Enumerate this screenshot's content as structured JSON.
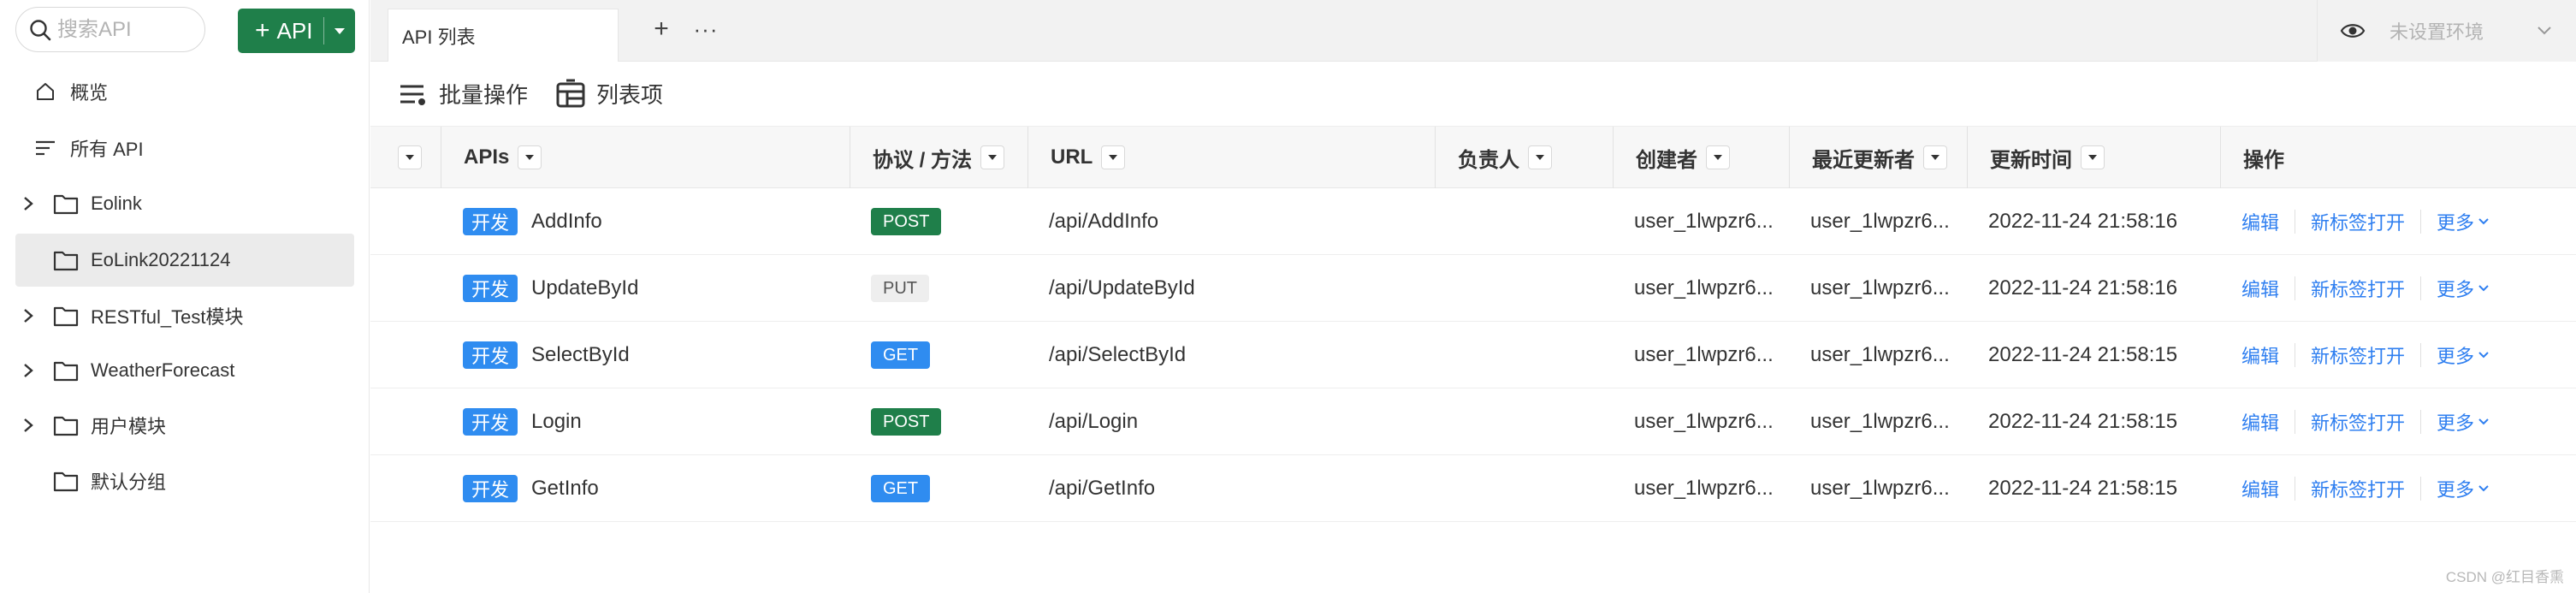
{
  "sidebar": {
    "search_placeholder": "搜索API",
    "add_api_label": "API",
    "items": [
      {
        "label": "概览"
      },
      {
        "label": "所有 API"
      }
    ],
    "tree": [
      {
        "label": "Eolink",
        "expandable": true
      },
      {
        "label": "EoLink20221124",
        "expandable": false,
        "active": true
      },
      {
        "label": "RESTful_Test模块",
        "expandable": true
      },
      {
        "label": "WeatherForecast",
        "expandable": true
      },
      {
        "label": "用户模块",
        "expandable": true
      },
      {
        "label": "默认分组",
        "expandable": false
      }
    ]
  },
  "tabs": {
    "active_label": "API 列表",
    "add_symbol": "+",
    "more_symbol": "···"
  },
  "environment": {
    "label": "未设置环境"
  },
  "toolbar": {
    "batch_label": "批量操作",
    "columns_label": "列表项"
  },
  "table": {
    "headers": {
      "apis": "APIs",
      "protocol": "协议 / 方法",
      "url": "URL",
      "owner": "负责人",
      "creator": "创建者",
      "updater": "最近更新者",
      "updated": "更新时间",
      "actions": "操作"
    },
    "rows": [
      {
        "status": "开发",
        "name": "AddInfo",
        "method": "POST",
        "url": "/api/AddInfo",
        "owner": "",
        "creator": "user_1lwpzr6...",
        "updater": "user_1lwpzr6...",
        "updated": "2022-11-24 21:58:16"
      },
      {
        "status": "开发",
        "name": "UpdateById",
        "method": "PUT",
        "url": "/api/UpdateById",
        "owner": "",
        "creator": "user_1lwpzr6...",
        "updater": "user_1lwpzr6...",
        "updated": "2022-11-24 21:58:16"
      },
      {
        "status": "开发",
        "name": "SelectById",
        "method": "GET",
        "url": "/api/SelectById",
        "owner": "",
        "creator": "user_1lwpzr6...",
        "updater": "user_1lwpzr6...",
        "updated": "2022-11-24 21:58:15"
      },
      {
        "status": "开发",
        "name": "Login",
        "method": "POST",
        "url": "/api/Login",
        "owner": "",
        "creator": "user_1lwpzr6...",
        "updater": "user_1lwpzr6...",
        "updated": "2022-11-24 21:58:15"
      },
      {
        "status": "开发",
        "name": "GetInfo",
        "method": "GET",
        "url": "/api/GetInfo",
        "owner": "",
        "creator": "user_1lwpzr6...",
        "updater": "user_1lwpzr6...",
        "updated": "2022-11-24 21:58:15"
      }
    ],
    "actions": {
      "edit": "编辑",
      "open_new_tab": "新标签打开",
      "more": "更多"
    }
  },
  "watermark": "CSDN @红目香熏",
  "colors": {
    "brand_green": "#1f7f4a",
    "dev_blue": "#2f8cf0",
    "link_blue": "#2f7ff0"
  },
  "icons": [
    "search-icon",
    "caret-down-icon",
    "home-icon",
    "list-icon",
    "chevron-right-icon",
    "folder-icon",
    "eye-icon",
    "chevron-down-icon",
    "batch-icon",
    "columns-icon",
    "sort-caret-icon"
  ]
}
